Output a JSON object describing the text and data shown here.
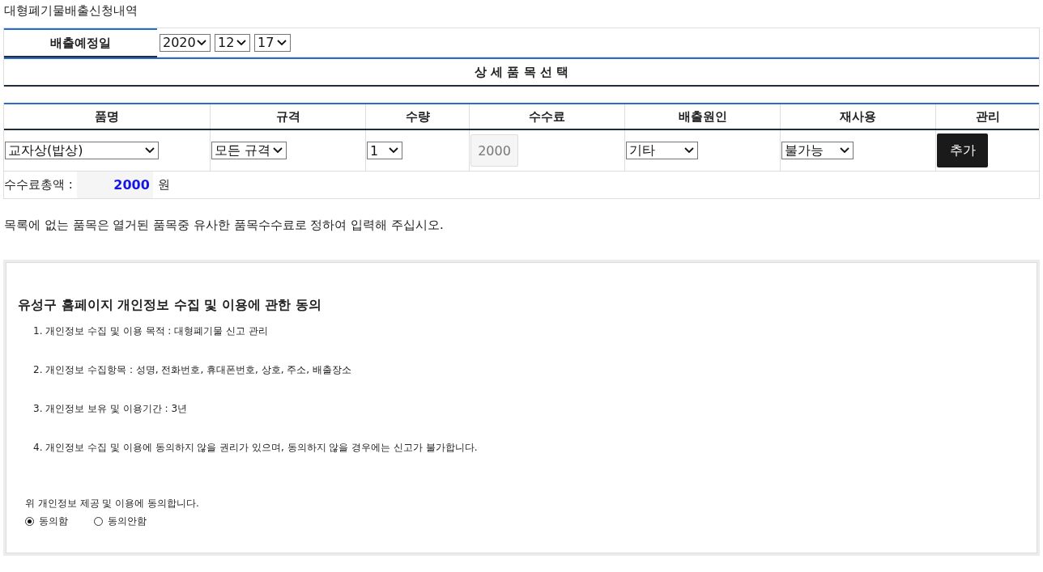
{
  "page_title": "대형폐기물배출신청내역",
  "date": {
    "label": "배출예정일",
    "year": "2020",
    "month": "12",
    "day": "17"
  },
  "section_title": "상 세 품 목 선 택",
  "columns": [
    "품명",
    "규격",
    "수량",
    "수수료",
    "배출원인",
    "재사용",
    "관리"
  ],
  "item_row": {
    "item": "교자상(밥상)",
    "spec": "모든 규격",
    "quantity": "1",
    "fee": "2000",
    "reason": "기타",
    "reuse": "불가능",
    "button": "추가"
  },
  "total": {
    "label": "수수료총액 :",
    "value": "2000",
    "unit": "원"
  },
  "note": "목록에 없는 품목은 열거된 품목중 유사한 품목수수료로 정하여 입력해 주십시오.",
  "consent": {
    "title": "유성구 홈페이지 개인정보 수집 및 이용에 관한 동의",
    "items": [
      "1. 개인정보 수집 및 이용 목적 : 대형폐기물 신고 관리",
      "2. 개인정보 수집항목 : 성명, 전화번호, 휴대폰번호, 상호, 주소, 배출장소",
      "3. 개인정보 보유 및 이용기간 : 3년",
      "4. 개인정보 수집 및 이용에 동의하지 않을 권리가 있으며, 동의하지 않을 경우에는 신고가 불가합니다."
    ],
    "question": "위 개인정보 제공 및 이용에 동의합니다.",
    "options": [
      {
        "label": "동의함",
        "selected": true
      },
      {
        "label": "동의안함",
        "selected": false
      }
    ]
  }
}
